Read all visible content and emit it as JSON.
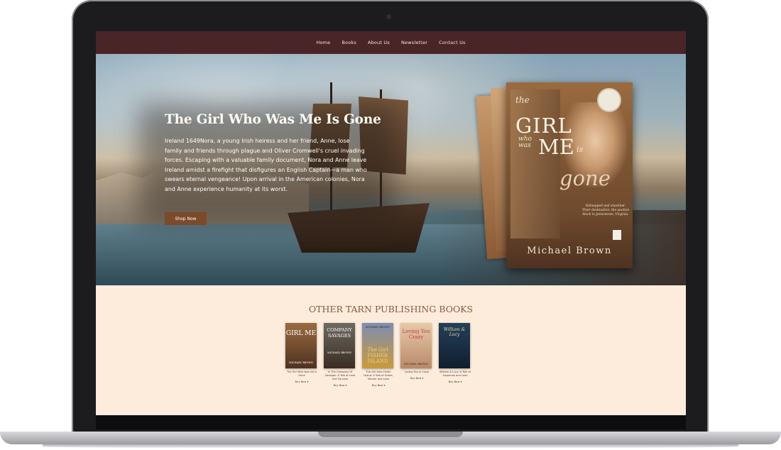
{
  "nav": {
    "items": [
      "Home",
      "Books",
      "About Us",
      "Newsletter",
      "Contact Us"
    ]
  },
  "hero": {
    "title": "The Girl Who Was Me Is Gone",
    "description": "Ireland 1649Nora, a young Irish heiress and her friend, Anne, lose family and friends through plague and Oliver Cromwell's cruel invading forces. Escaping with a valuable family document, Nora and Anne leave Ireland amidst a firefight that disfigures an English Captain—a man who swears eternal vengeance! Upon arrival in the American colonies, Nora and Anne experience humanity at its worst.",
    "cta": "Shop Now"
  },
  "cover": {
    "the": "the",
    "girl": "GIRL",
    "who_was": "who was",
    "me": "ME",
    "is": "is",
    "gone": "gone",
    "blurb": "Kidnapped and shackled. Their destination, the auction block in Jamestown, Virginia.",
    "author": "Michael Brown"
  },
  "other_books": {
    "heading": "OTHER TARN PUBLISHING BOOKS",
    "books": [
      {
        "cover_text": "GIRL ME",
        "cover_author": "MICHAEL BROWN",
        "caption": "The Girl Who was me is Gone",
        "buy": "Buy Now"
      },
      {
        "cover_text": "COMPANY SAVAGES",
        "cover_author": "MICHAEL BROWN",
        "caption": "In The Company Of Savages: A Tale of Love and Survival",
        "buy": "Buy Now"
      },
      {
        "cover_text": "The Girl FISHER ISLAND",
        "cover_author": "MICHAEL BROWN",
        "caption": "The Girl from Fisher Island: A Tale of Greed, Murder and Love",
        "buy": "Buy Now"
      },
      {
        "cover_text": "Loving You Crazy",
        "cover_author": "MICHAEL BROWN",
        "caption": "Loving You Is Crazy",
        "buy": "Buy Now"
      },
      {
        "cover_text": "William & Lucy",
        "cover_author": "",
        "caption": "William & Lucy: A Tale of Suspense and Love",
        "buy": "Buy Now"
      }
    ]
  },
  "colors": {
    "nav_bg": "#4a2528",
    "section_bg": "#fdecdc",
    "heading_accent": "#8b5a3a",
    "button_bg": "#7a4a2a"
  }
}
